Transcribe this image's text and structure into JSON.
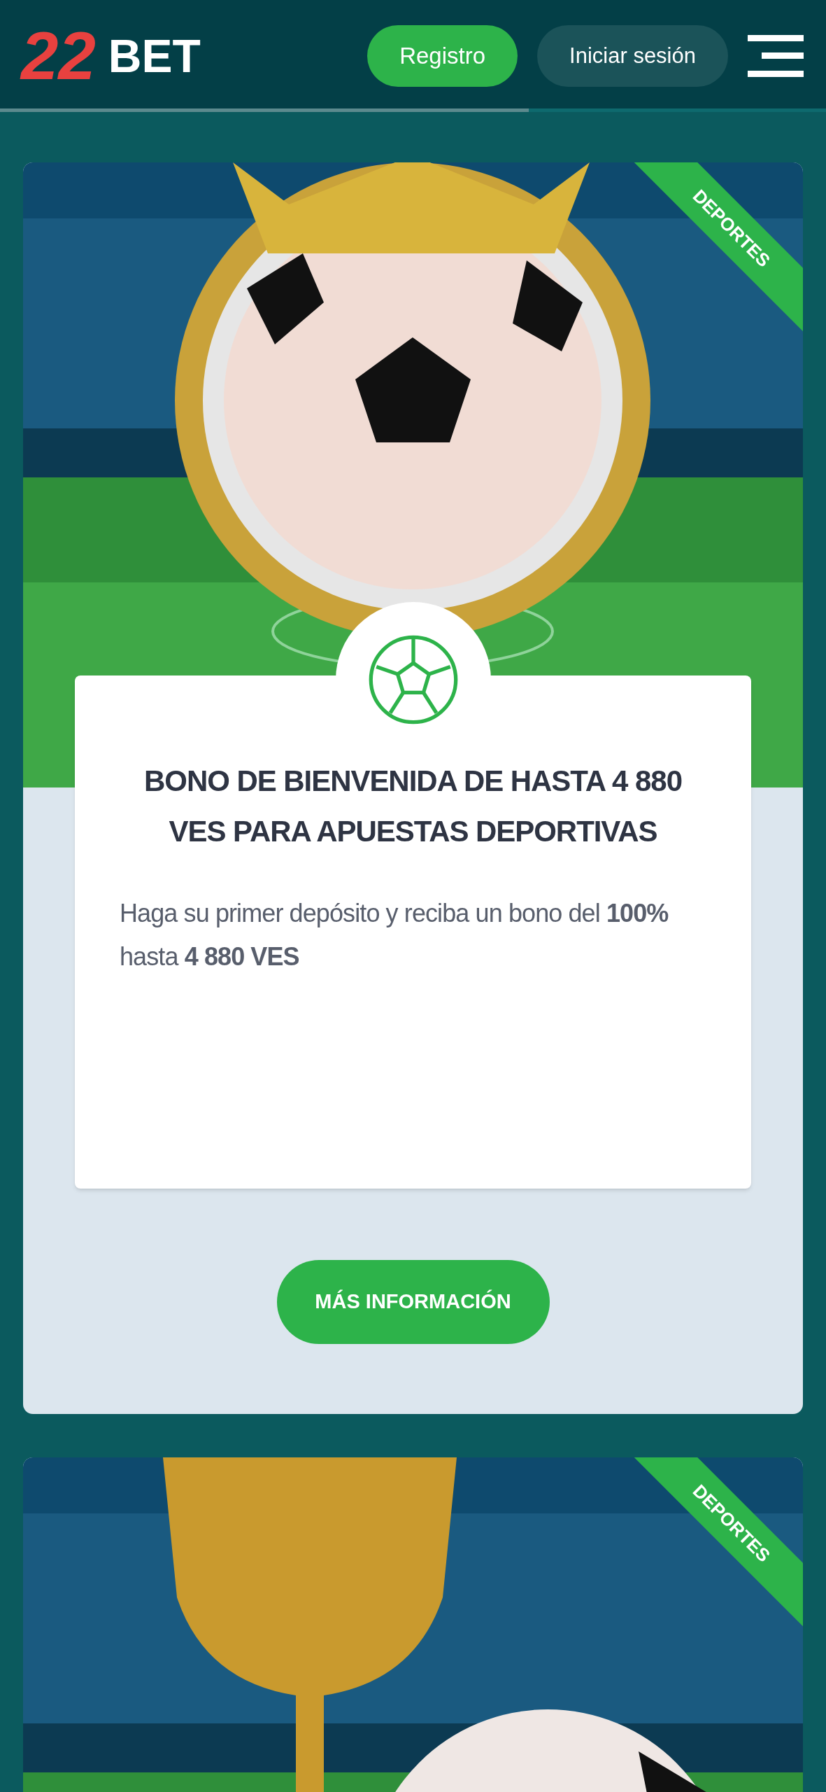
{
  "header": {
    "logo": {
      "numeral": "22",
      "word": "BET"
    },
    "buttons": [
      {
        "kind": "primary",
        "label": "Registro"
      },
      {
        "kind": "secondary",
        "label": "Iniciar sesión"
      }
    ],
    "loading_bar": {
      "level": 0.64
    }
  },
  "promos": [
    {
      "ribbon": "DEPORTES",
      "title": "BONO DE BIENVENIDA DE HASTA 4 880 VES PARA APUESTAS DEPORTIVAS",
      "text": "Haga su primer depósito y reciba un bono del **100%** hasta **4 880 VES**",
      "button": "MÁS INFORMACIÓN"
    },
    {
      "ribbon": "DEPORTES"
    }
  ]
}
